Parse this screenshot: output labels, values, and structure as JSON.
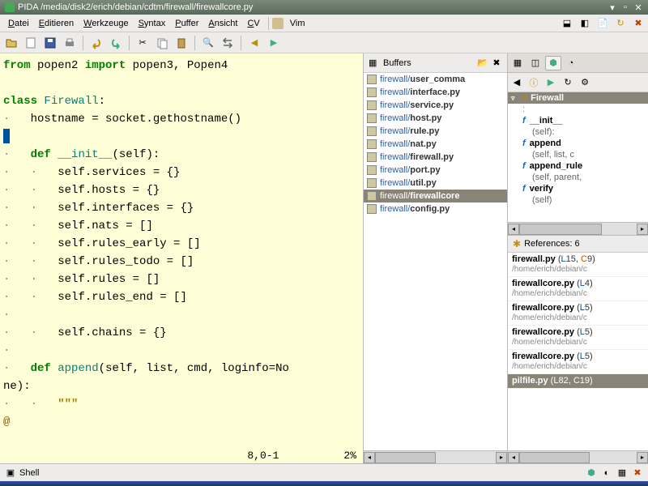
{
  "title": "PIDA /media/disk2/erich/debian/cdtm/firewall/firewallcore.py",
  "menubar": [
    {
      "label": "Datei",
      "u": 0
    },
    {
      "label": "Editieren",
      "u": 0
    },
    {
      "label": "Werkzeuge",
      "u": 0
    },
    {
      "label": "Syntax",
      "u": 0
    },
    {
      "label": "Puffer",
      "u": 0
    },
    {
      "label": "Ansicht",
      "u": 0
    },
    {
      "label": "CV",
      "u": 0
    }
  ],
  "vim_label": "Vim",
  "toolbar_icons": [
    "open",
    "new",
    "save",
    "print",
    "undo",
    "redo",
    "cut",
    "copy",
    "paste",
    "find",
    "replace",
    "prev",
    "next"
  ],
  "editor": {
    "lines": [
      {
        "t": "import",
        "raw": "from popen2 import popen3, Popen4"
      },
      {
        "t": "blank"
      },
      {
        "t": "class",
        "raw": "class Firewall:"
      },
      {
        "t": "assign",
        "raw": "    hostname = socket.gethostname()"
      },
      {
        "t": "cursor"
      },
      {
        "t": "def",
        "raw": "    def __init__(self):"
      },
      {
        "t": "stmt",
        "raw": "        self.services = {}"
      },
      {
        "t": "stmt",
        "raw": "        self.hosts = {}"
      },
      {
        "t": "stmt",
        "raw": "        self.interfaces = {}"
      },
      {
        "t": "stmt",
        "raw": "        self.nats = []"
      },
      {
        "t": "stmt",
        "raw": "        self.rules_early = []"
      },
      {
        "t": "stmt",
        "raw": "        self.rules_todo = []"
      },
      {
        "t": "stmt",
        "raw": "        self.rules = []"
      },
      {
        "t": "stmt",
        "raw": "        self.rules_end = []"
      },
      {
        "t": "blank-dot"
      },
      {
        "t": "stmt",
        "raw": "        self.chains = {}"
      },
      {
        "t": "blank-dot"
      },
      {
        "t": "def2",
        "raw": "    def append(self, list, cmd, loginfo=No"
      },
      {
        "t": "cont",
        "raw": "ne):"
      },
      {
        "t": "str",
        "raw": "        \"\"\""
      },
      {
        "t": "at",
        "raw": "@"
      }
    ],
    "status_pos": "8,0-1",
    "status_pct": "2%"
  },
  "buffers": {
    "title": "Buffers",
    "items": [
      {
        "path": "firewall/",
        "name": "user_comma"
      },
      {
        "path": "firewall/",
        "name": "interface.py"
      },
      {
        "path": "firewall/",
        "name": "service.py"
      },
      {
        "path": "firewall/",
        "name": "host.py"
      },
      {
        "path": "firewall/",
        "name": "rule.py"
      },
      {
        "path": "firewall/",
        "name": "nat.py"
      },
      {
        "path": "firewall/",
        "name": "firewall.py"
      },
      {
        "path": "firewall/",
        "name": "port.py"
      },
      {
        "path": "firewall/",
        "name": "util.py"
      },
      {
        "path": "firewall/",
        "name": "firewallcore",
        "selected": true
      },
      {
        "path": "firewall/",
        "name": "config.py"
      }
    ]
  },
  "outline": {
    "class_name": "Firewall",
    "items": [
      {
        "name": "__init__",
        "args": "(self):"
      },
      {
        "name": "append",
        "args": "(self, list, c"
      },
      {
        "name": "append_rule",
        "args": "(self, parent,"
      },
      {
        "name": "verify",
        "args": "(self)"
      }
    ]
  },
  "references": {
    "title": "References:",
    "count": "6",
    "items": [
      {
        "file": "firewall.py",
        "line": "15",
        "col": "9",
        "path": "/home/erich/debian/c"
      },
      {
        "file": "firewallcore.py",
        "line": "4",
        "col": "",
        "path": "/home/erich/debian/c"
      },
      {
        "file": "firewallcore.py",
        "line": "5",
        "col": "",
        "path": "/home/erich/debian/c"
      },
      {
        "file": "firewallcore.py",
        "line": "5",
        "col": "",
        "path": "/home/erich/debian/c"
      },
      {
        "file": "firewallcore.py",
        "line": "5",
        "col": "",
        "path": "/home/erich/debian/c"
      },
      {
        "file": "pilfile.py",
        "line": "82",
        "col": "19",
        "path": "",
        "selected": true
      }
    ]
  },
  "shell": {
    "title": "Shell"
  }
}
